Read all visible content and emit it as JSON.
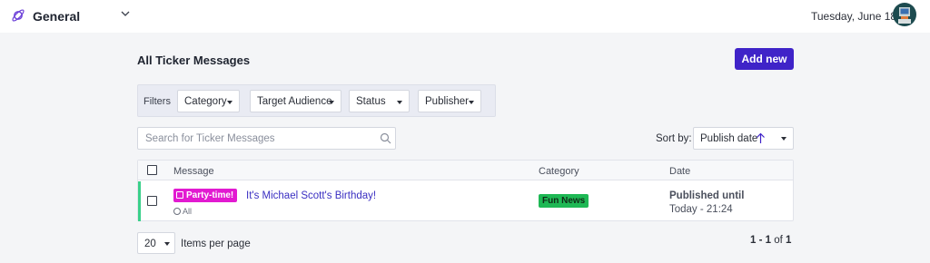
{
  "header": {
    "workspace_name": "General",
    "date": "Tuesday, June 18"
  },
  "page": {
    "title": "All Ticker Messages",
    "add_new_label": "Add new"
  },
  "filters": {
    "label": "Filters",
    "items": [
      {
        "label": "Category"
      },
      {
        "label": "Target Audience"
      },
      {
        "label": "Status"
      },
      {
        "label": "Publisher"
      }
    ]
  },
  "search": {
    "placeholder": "Search for Ticker Messages",
    "value": ""
  },
  "sort": {
    "label": "Sort by:",
    "value": "Publish date",
    "direction": "ascending"
  },
  "table": {
    "columns": [
      "Message",
      "Category",
      "Date"
    ],
    "rows": [
      {
        "tag": "Party-time!",
        "message": "It's Michael Scott's Birthday!",
        "audience": "All",
        "category": "Fun News",
        "date_status": "Published until",
        "date_time": "Today - 21:24",
        "accent_color": "#3ad08a"
      }
    ]
  },
  "footer": {
    "per_page_value": "20",
    "per_page_label": "Items per page",
    "range_start": "1",
    "range_sep": " - ",
    "range_end": "1",
    "of_label": " of ",
    "total": "1"
  },
  "colors": {
    "primary": "#3f23c8",
    "tag_party": "#e21ad1",
    "tag_category": "#1eb854",
    "link": "#3a2fc2"
  },
  "icons": [
    "planet-logo-icon",
    "chevron-down-icon",
    "avatar",
    "caret-down-icon",
    "search-icon",
    "arrow-up-icon",
    "calendar-icon",
    "globe-icon"
  ]
}
